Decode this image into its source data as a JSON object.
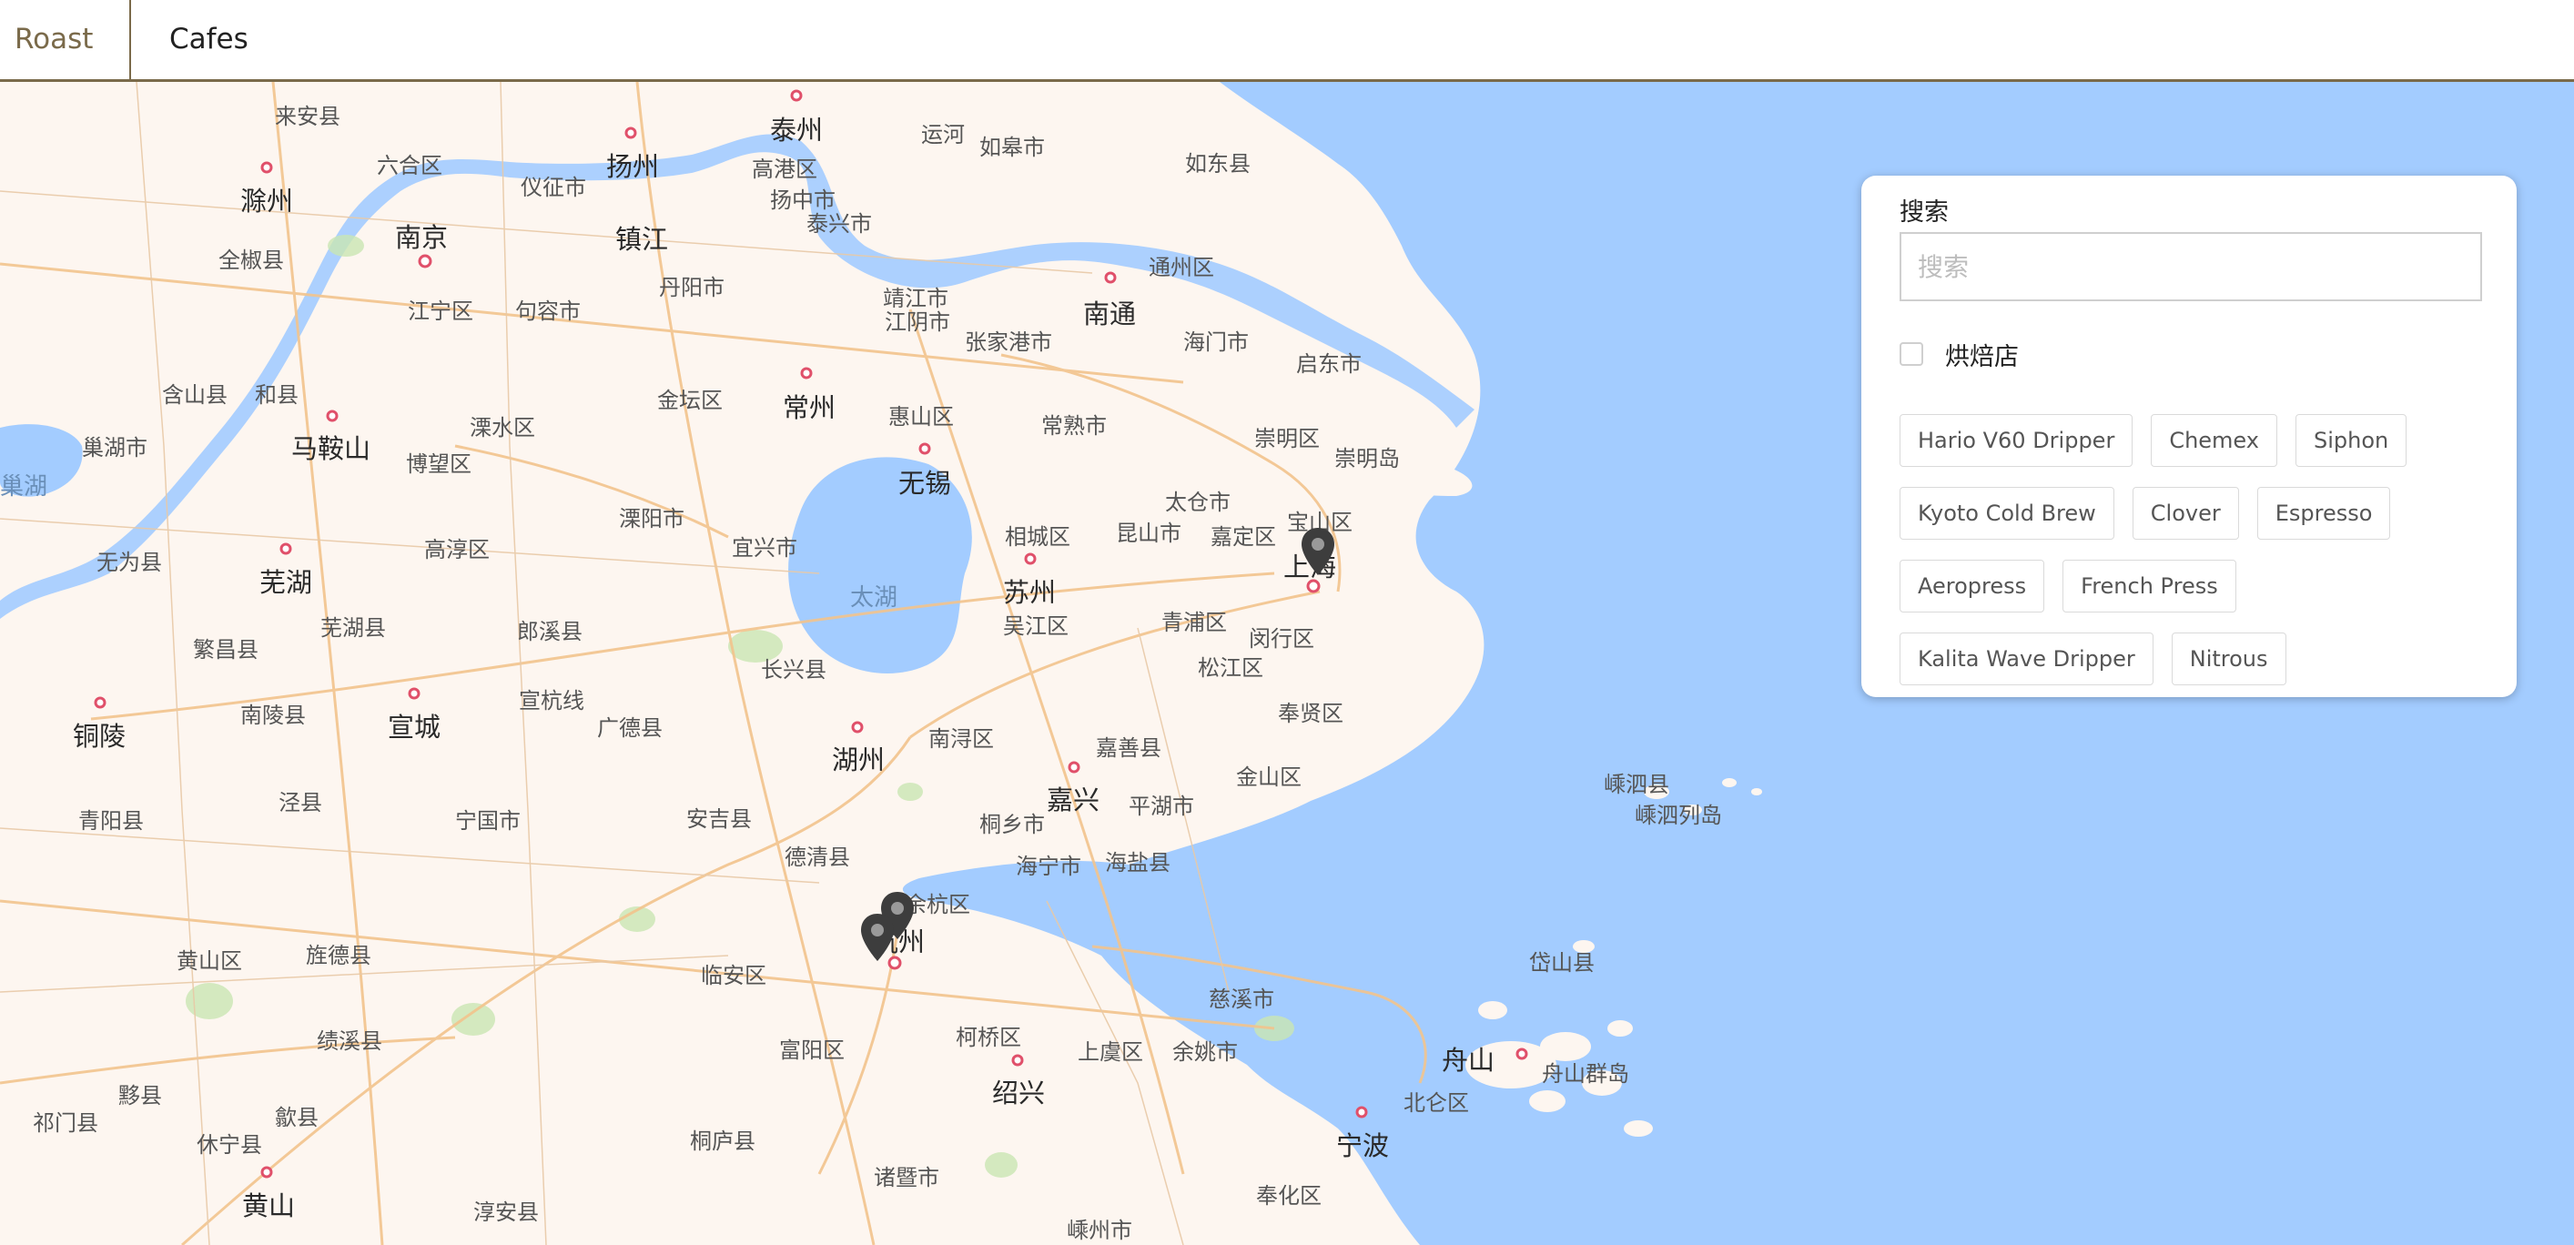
{
  "nav": {
    "brand": "Roast",
    "cafes_link": "Cafes"
  },
  "map": {
    "labels": {
      "nanjing": "南京",
      "yangzhou": "扬州",
      "taizhou": "泰州",
      "zhenjiang": "镇江",
      "changzhou": "常州",
      "wuxi": "无锡",
      "suzhou": "苏州",
      "shanghai": "上海",
      "nantong": "南通",
      "hangzhou": "杭州",
      "shaoxing": "绍兴",
      "ningbo": "宁波",
      "zhoushan": "舟山",
      "huzhou": "湖州",
      "jiaxing": "嘉兴",
      "wuhu": "芜湖",
      "maanshan": "马鞍山",
      "xuancheng": "宣城",
      "tongling": "铜陵",
      "huangshan": "黄山",
      "chuzhou": "滁州",
      "taihu": "太湖",
      "laian": "来安县",
      "liuhe": "六合区",
      "yizheng": "仪征市",
      "gaogang": "高港区",
      "rugao": "如皋市",
      "rudong": "如东县",
      "yangzhong": "扬中市",
      "taixing": "泰兴市",
      "quanjiao": "全椒县",
      "jiangning": "江宁区",
      "jurong": "句容市",
      "danyang": "丹阳市",
      "jingjiang": "靖江市",
      "jiangyin": "江阴市",
      "zhangjiagang": "张家港市",
      "haimen": "海门市",
      "qidong": "启东市",
      "tongzhou": "通州区",
      "hanshan": "含山县",
      "hexian": "和县",
      "liyang": "溧阳市",
      "lishui": "溧水区",
      "bowang": "博望区",
      "jintan": "金坛区",
      "huishan": "惠山区",
      "changshu": "常熟市",
      "chongming": "崇明区",
      "chongmingdao": "崇明岛",
      "taicang": "太仓市",
      "baoshan": "宝山区",
      "jiading": "嘉定区",
      "kunshan": "昆山市",
      "xiangcheng": "相城区",
      "yixing": "宜兴市",
      "gaochun": "高淳区",
      "wuwei": "无为县",
      "fanchang": "繁昌县",
      "wuhuxian": "芜湖县",
      "langxi": "郎溪县",
      "changxing": "长兴县",
      "guangde": "广德县",
      "xuanzhou": "宣杭线",
      "wujiang": "吴江区",
      "qingpu": "青浦区",
      "minhang": "闵行区",
      "songjiang": "松江区",
      "fengxian": "奉贤区",
      "jinshan": "金山区",
      "jiashan": "嘉善县",
      "pinghu": "平湖市",
      "nanxun": "南浔区",
      "tongxiang": "桐乡市",
      "haining": "海宁市",
      "haiyan": "海盐县",
      "deqing": "德清县",
      "anji": "安吉县",
      "ningguo": "宁国市",
      "nanling": "南陵县",
      "jingxian": "泾县",
      "qingyang": "青阳县",
      "huangshanqu": "黄山区",
      "jingde": "旌德县",
      "jixi": "绩溪县",
      "yixian": "黟县",
      "qimen": "祁门县",
      "xiuning": "休宁县",
      "shexian": "歙县",
      "linan": "临安区",
      "yuhang": "余杭区",
      "fuyang": "富阳区",
      "keqiao": "柯桥区",
      "shangyu": "上虞区",
      "yuyao": "余姚市",
      "cixi": "慈溪市",
      "beilun": "北仑区",
      "fenghua": "奉化区",
      "tonglu": "桐庐县",
      "zhuji": "诸暨市",
      "shengzhou": "嵊州市",
      "chunan": "淳安县",
      "shengsi": "嵊泗县",
      "shengsiislands": "嵊泗列岛",
      "daishan": "岱山县",
      "zhoushanislands": "舟山群岛",
      "chaohu": "巢湖市",
      "chaohu_lake": "巢湖",
      "yunhe": "运河"
    }
  },
  "panel": {
    "search_label": "搜索",
    "search_placeholder": "搜索",
    "search_value": "",
    "roaster_label": "烘焙店",
    "brew_methods": [
      "Hario V60 Dripper",
      "Chemex",
      "Siphon",
      "Kyoto Cold Brew",
      "Clover",
      "Espresso",
      "Aeropress",
      "French Press",
      "Kalita Wave Dripper",
      "Nitrous"
    ]
  },
  "colors": {
    "accent": "#7a6a4a",
    "water": "#a3ccff",
    "land": "#fdf6f0",
    "road": "#f2c48d",
    "pin": "#3d3d3d"
  }
}
